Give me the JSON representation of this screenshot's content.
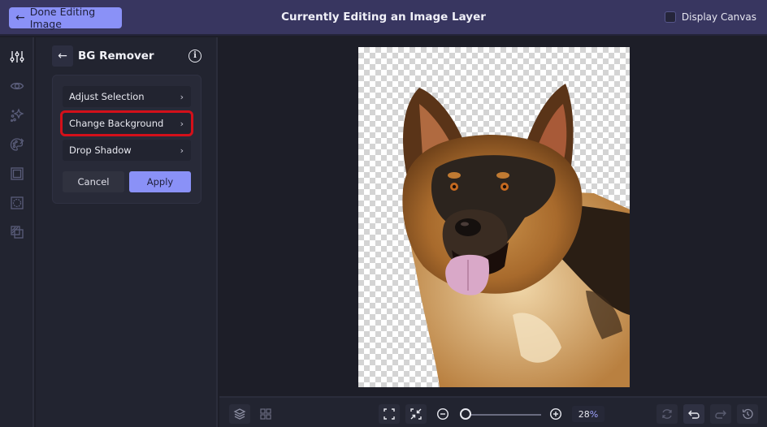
{
  "topbar": {
    "done_button": "Done Editing Image",
    "title": "Currently Editing an Image Layer",
    "display_canvas_label": "Display Canvas",
    "display_canvas_checked": false
  },
  "iconbar": {
    "items": [
      {
        "icon": "sliders-icon",
        "active": true
      },
      {
        "icon": "eye-icon",
        "active": false
      },
      {
        "icon": "sparkles-icon",
        "active": false
      },
      {
        "icon": "palette-icon",
        "active": false
      },
      {
        "icon": "frame-icon",
        "active": false
      },
      {
        "icon": "border-icon",
        "active": false
      },
      {
        "icon": "overlay-icon",
        "active": false
      }
    ]
  },
  "panel": {
    "title": "BG Remover",
    "options": [
      {
        "label": "Adjust Selection",
        "chevron": "›"
      },
      {
        "label": "Change Background",
        "chevron": "›",
        "highlighted": true
      },
      {
        "label": "Drop Shadow",
        "chevron": "›"
      }
    ],
    "cancel_label": "Cancel",
    "apply_label": "Apply"
  },
  "canvas": {
    "subject": "German Shepherd dog, background removed (transparent checkerboard)"
  },
  "bottombar": {
    "zoom_value": "28",
    "zoom_unit": "%",
    "zoom_slider_fraction": 0.05
  },
  "colors": {
    "accent": "#8a91f7",
    "topbar_bg": "#383660",
    "highlight": "#d4101a",
    "panel_bg": "#222430",
    "stage_bg": "#1d1e28"
  }
}
